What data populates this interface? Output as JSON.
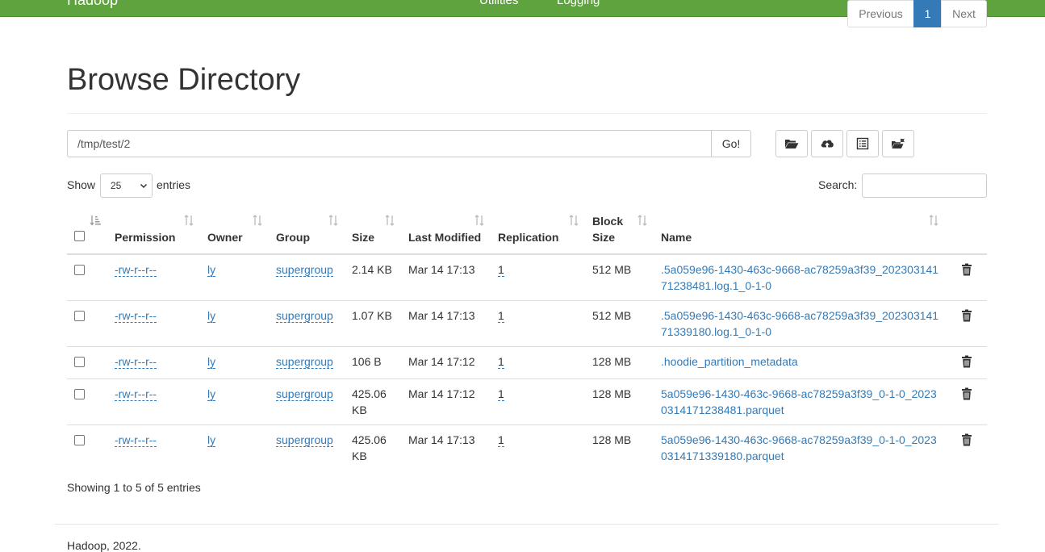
{
  "navbar": {
    "brand": "Hadoop",
    "links": [
      "Utilities",
      "Logging"
    ]
  },
  "page": {
    "title": "Browse Directory"
  },
  "path_bar": {
    "value": "/tmp/test/2",
    "go_label": "Go!"
  },
  "toolbar_icons": [
    "folder-open-icon",
    "cloud-upload-icon",
    "list-alt-icon",
    "cut-folder-icon"
  ],
  "table_controls": {
    "show_label": "Show",
    "entries_value": "25",
    "entries_label": "entries",
    "search_label": "Search:"
  },
  "table": {
    "headers": [
      "Permission",
      "Owner",
      "Group",
      "Size",
      "Last Modified",
      "Replication",
      "Block Size",
      "Name"
    ],
    "rows": [
      {
        "permission": "-rw-r--r--",
        "owner": "ly",
        "group": "supergroup",
        "size": "2.14 KB",
        "modified": "Mar 14 17:13",
        "replication": "1",
        "block_size": "512 MB",
        "name": ".5a059e96-1430-463c-9668-ac78259a3f39_20230314171238481.log.1_0-1-0"
      },
      {
        "permission": "-rw-r--r--",
        "owner": "ly",
        "group": "supergroup",
        "size": "1.07 KB",
        "modified": "Mar 14 17:13",
        "replication": "1",
        "block_size": "512 MB",
        "name": ".5a059e96-1430-463c-9668-ac78259a3f39_20230314171339180.log.1_0-1-0"
      },
      {
        "permission": "-rw-r--r--",
        "owner": "ly",
        "group": "supergroup",
        "size": "106 B",
        "modified": "Mar 14 17:12",
        "replication": "1",
        "block_size": "128 MB",
        "name": ".hoodie_partition_metadata"
      },
      {
        "permission": "-rw-r--r--",
        "owner": "ly",
        "group": "supergroup",
        "size": "425.06 KB",
        "modified": "Mar 14 17:12",
        "replication": "1",
        "block_size": "128 MB",
        "name": "5a059e96-1430-463c-9668-ac78259a3f39_0-1-0_20230314171238481.parquet"
      },
      {
        "permission": "-rw-r--r--",
        "owner": "ly",
        "group": "supergroup",
        "size": "425.06 KB",
        "modified": "Mar 14 17:13",
        "replication": "1",
        "block_size": "128 MB",
        "name": "5a059e96-1430-463c-9668-ac78259a3f39_0-1-0_20230314171339180.parquet"
      }
    ]
  },
  "footer": {
    "showing": "Showing 1 to 5 of 5 entries",
    "prev_label": "Previous",
    "current_page": "1",
    "next_label": "Next",
    "copyright": "Hadoop, 2022."
  },
  "colors": {
    "navbar": "#5fa33e",
    "link": "#337ab7",
    "active_page": "#337ab7"
  }
}
